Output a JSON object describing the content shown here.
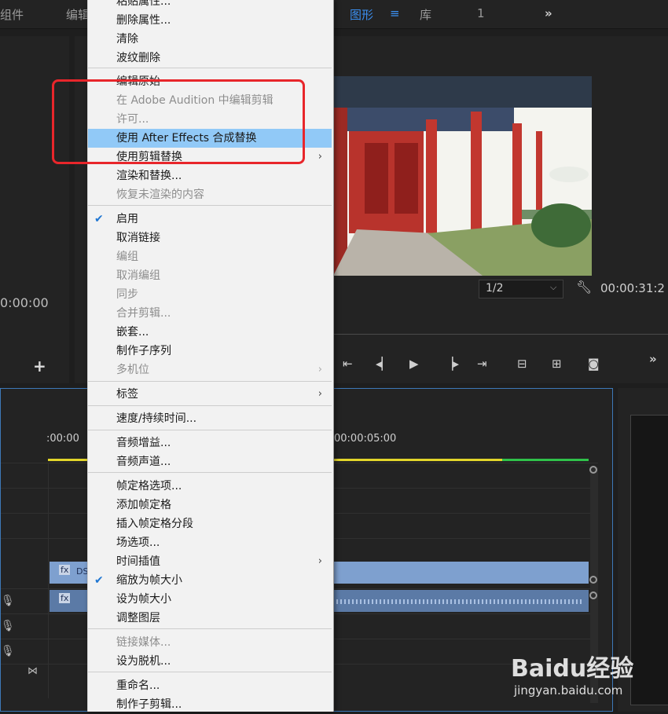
{
  "topbar": {
    "tabs": [
      {
        "label": "组件"
      },
      {
        "label": "编辑"
      },
      {
        "label": "图形"
      },
      {
        "label": "≡"
      },
      {
        "label": "库"
      },
      {
        "label": "1"
      },
      {
        "label": "»"
      }
    ]
  },
  "left_panel": {
    "timecode": "0:00:00",
    "add_label": "+"
  },
  "program": {
    "fit_value": "1/2",
    "timecode": "00:00:31:2",
    "more_label": "»"
  },
  "timeline": {
    "ruler_start": ":00:00",
    "ruler_mark": "00:00:05:00",
    "clip_v_label": "DS",
    "fx_label": "fx"
  },
  "watermark": {
    "brand": "Baidu经验",
    "url": "jingyan.baidu.com"
  },
  "menu": {
    "items": [
      {
        "label": "粘贴属性...",
        "disabled": false,
        "checked": false,
        "submenu": false
      },
      {
        "label": "删除属性...",
        "disabled": false,
        "checked": false,
        "submenu": false
      },
      {
        "label": "清除",
        "disabled": false,
        "checked": false,
        "submenu": false
      },
      {
        "label": "波纹删除",
        "disabled": false,
        "checked": false,
        "submenu": false
      },
      {
        "label": "编辑原始",
        "disabled": false,
        "checked": false,
        "submenu": false
      },
      {
        "label": "在 Adobe Audition 中编辑剪辑",
        "disabled": true,
        "checked": false,
        "submenu": false
      },
      {
        "label": "许可...",
        "disabled": true,
        "checked": false,
        "submenu": false
      },
      {
        "label": "使用 After Effects 合成替换",
        "disabled": false,
        "checked": false,
        "submenu": false,
        "highlighted": true
      },
      {
        "label": "使用剪辑替换",
        "disabled": false,
        "checked": false,
        "submenu": true
      },
      {
        "label": "渲染和替换...",
        "disabled": false,
        "checked": false,
        "submenu": false
      },
      {
        "label": "恢复未渲染的内容",
        "disabled": true,
        "checked": false,
        "submenu": false
      },
      {
        "label": "启用",
        "disabled": false,
        "checked": true,
        "submenu": false
      },
      {
        "label": "取消链接",
        "disabled": false,
        "checked": false,
        "submenu": false
      },
      {
        "label": "编组",
        "disabled": true,
        "checked": false,
        "submenu": false
      },
      {
        "label": "取消编组",
        "disabled": true,
        "checked": false,
        "submenu": false
      },
      {
        "label": "同步",
        "disabled": true,
        "checked": false,
        "submenu": false
      },
      {
        "label": "合并剪辑...",
        "disabled": true,
        "checked": false,
        "submenu": false
      },
      {
        "label": "嵌套...",
        "disabled": false,
        "checked": false,
        "submenu": false
      },
      {
        "label": "制作子序列",
        "disabled": false,
        "checked": false,
        "submenu": false
      },
      {
        "label": "多机位",
        "disabled": true,
        "checked": false,
        "submenu": true
      },
      {
        "label": "标签",
        "disabled": false,
        "checked": false,
        "submenu": true
      },
      {
        "label": "速度/持续时间...",
        "disabled": false,
        "checked": false,
        "submenu": false
      },
      {
        "label": "音频增益...",
        "disabled": false,
        "checked": false,
        "submenu": false
      },
      {
        "label": "音频声道...",
        "disabled": false,
        "checked": false,
        "submenu": false
      },
      {
        "label": "帧定格选项...",
        "disabled": false,
        "checked": false,
        "submenu": false
      },
      {
        "label": "添加帧定格",
        "disabled": false,
        "checked": false,
        "submenu": false
      },
      {
        "label": "插入帧定格分段",
        "disabled": false,
        "checked": false,
        "submenu": false
      },
      {
        "label": "场选项...",
        "disabled": false,
        "checked": false,
        "submenu": false
      },
      {
        "label": "时间插值",
        "disabled": false,
        "checked": false,
        "submenu": true
      },
      {
        "label": "缩放为帧大小",
        "disabled": false,
        "checked": true,
        "submenu": false
      },
      {
        "label": "设为帧大小",
        "disabled": false,
        "checked": false,
        "submenu": false
      },
      {
        "label": "调整图层",
        "disabled": false,
        "checked": false,
        "submenu": false
      },
      {
        "label": "链接媒体...",
        "disabled": true,
        "checked": false,
        "submenu": false
      },
      {
        "label": "设为脱机...",
        "disabled": false,
        "checked": false,
        "submenu": false
      },
      {
        "label": "重命名...",
        "disabled": false,
        "checked": false,
        "submenu": false
      },
      {
        "label": "制作子剪辑...",
        "disabled": false,
        "checked": false,
        "submenu": false
      }
    ]
  }
}
